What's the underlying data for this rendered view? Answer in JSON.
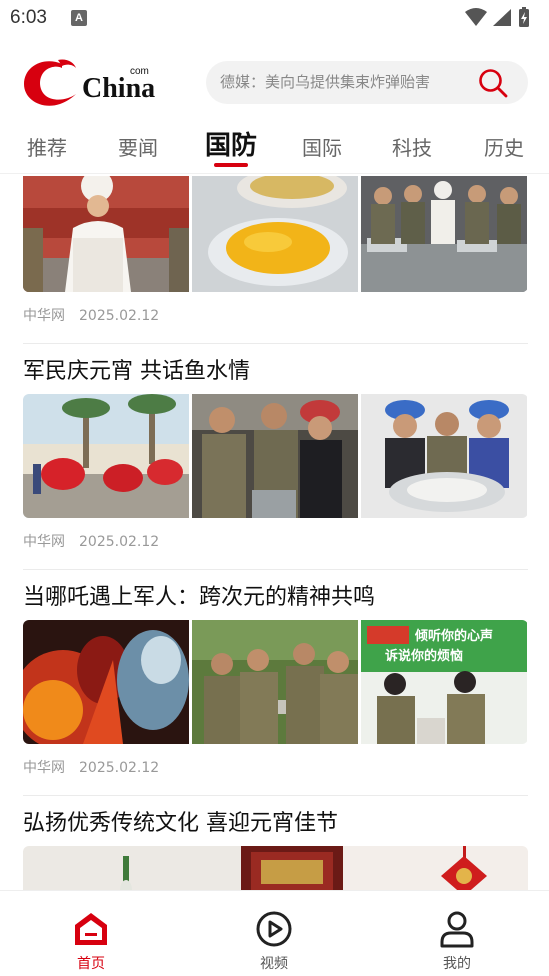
{
  "status_bar": {
    "time": "6:03"
  },
  "header": {
    "logo_text": "China",
    "logo_sup": "com",
    "search_placeholder": "德媒：美向乌提供集束炸弹贻害"
  },
  "tabs": [
    {
      "label": "推荐"
    },
    {
      "label": "要闻"
    },
    {
      "label": "国防",
      "active": true
    },
    {
      "label": "国际"
    },
    {
      "label": "科技"
    },
    {
      "label": "历史"
    }
  ],
  "articles": [
    {
      "title": "",
      "source": "中华网",
      "date": "2025.02.12"
    },
    {
      "title": "军民庆元宵 共话鱼水情",
      "source": "中华网",
      "date": "2025.02.12"
    },
    {
      "title": "当哪吒遇上军人：跨次元的精神共鸣",
      "source": "中华网",
      "date": "2025.02.12"
    },
    {
      "title": "弘扬优秀传统文化 喜迎元宵佳节",
      "source": "",
      "date": ""
    }
  ],
  "thumb_overlay_text": {
    "a3_sign_line1": "倾听你的心声",
    "a3_sign_line2": "诉说你的烦恼"
  },
  "bottom_nav": [
    {
      "label": "首页",
      "icon": "home-icon",
      "active": true
    },
    {
      "label": "视频",
      "icon": "video-play-icon"
    },
    {
      "label": "我的",
      "icon": "profile-icon"
    }
  ],
  "colors": {
    "accent": "#d7000f"
  }
}
